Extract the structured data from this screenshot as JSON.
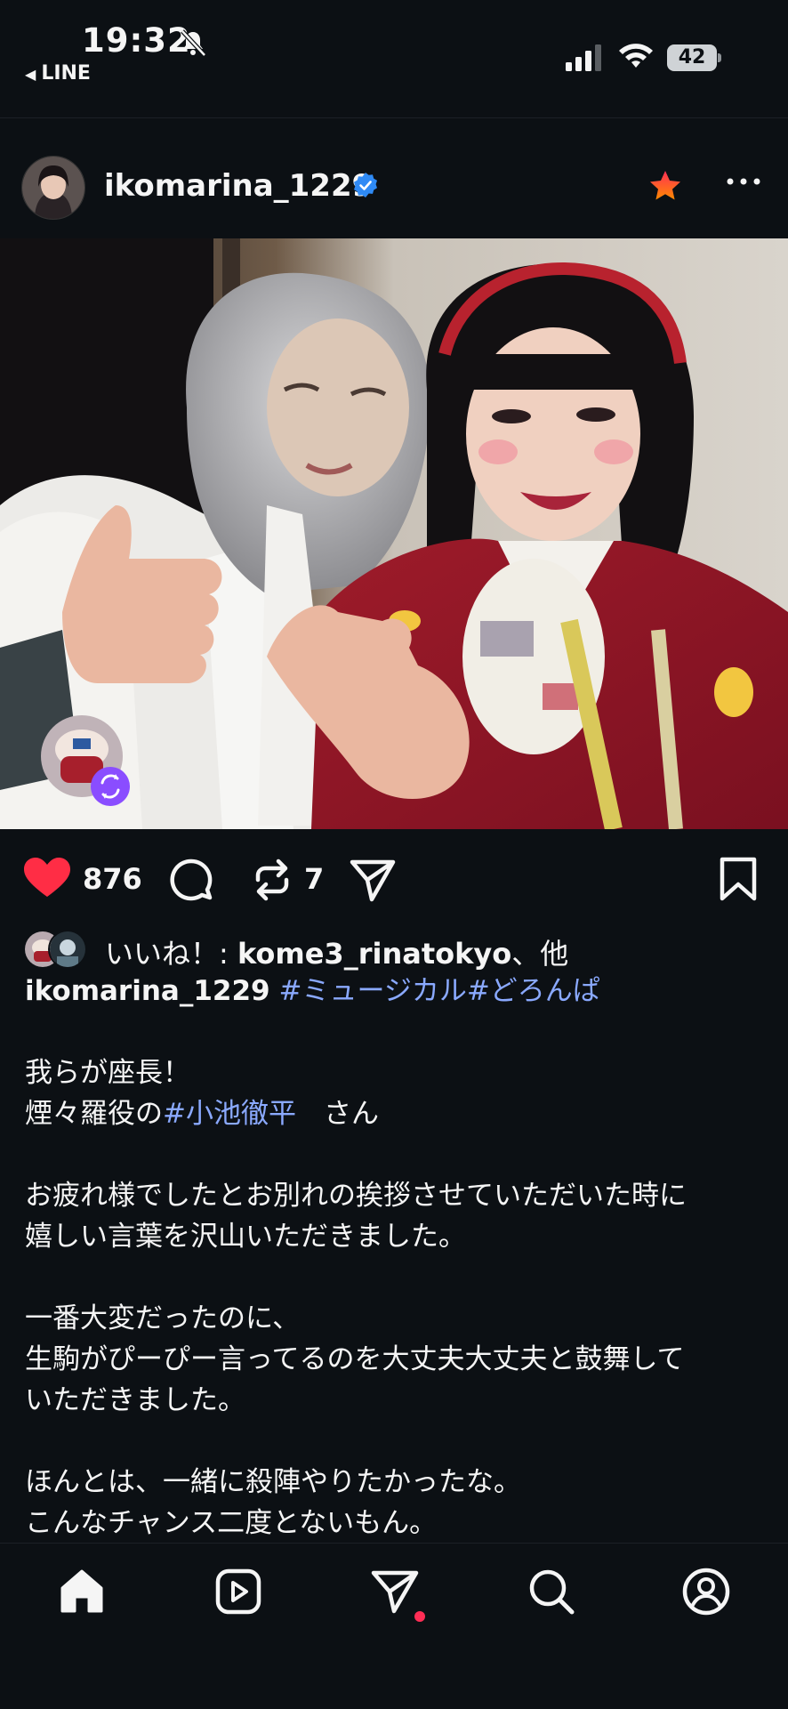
{
  "status_bar": {
    "time": "19:32",
    "back_app": "LINE",
    "battery": "42"
  },
  "post": {
    "username": "ikomarina_1229",
    "verified": true,
    "like_count": "876",
    "repost_count": "7",
    "liked_by_prefix": "いいね！: ",
    "liked_by_user": "kome3_rinatokyo",
    "liked_by_suffix": "、他",
    "caption": {
      "user": "ikomarina_1229",
      "hashtags_line1": "#ミュージカル#どろんぱ",
      "line_a": "我らが座長！",
      "line_b_pre": "煙々羅役の",
      "line_b_tag": "#小池徹平",
      "line_b_post": "　さん",
      "line_c": "お疲れ様でしたとお別れの挨拶させていただいた時に",
      "line_d": "嬉しい言葉を沢山いただきました。",
      "line_e": "一番大変だったのに、",
      "line_f": "生駒がぴーぴー言ってるのを大丈夫大丈夫と鼓舞して",
      "line_g": "いただきました。",
      "line_h": "ほんとは、一緒に殺陣やりたかったな。",
      "line_i": "こんなチャンス二度とないもん。"
    }
  },
  "icons": {
    "like": "heart-filled-icon",
    "comment": "comment-icon",
    "repost": "repost-icon",
    "share": "send-icon",
    "save": "bookmark-icon",
    "favorite": "star-icon",
    "more": "more-icon",
    "nav": [
      "home-icon",
      "reels-icon",
      "direct-icon",
      "search-icon",
      "profile-icon"
    ]
  },
  "colors": {
    "background": "#0c1014",
    "like": "#ff2d45",
    "hashtag": "#8aa9ff",
    "verified": "#2f8af5",
    "star": "#ff5a1f",
    "notification_dot": "#ff2d55"
  }
}
